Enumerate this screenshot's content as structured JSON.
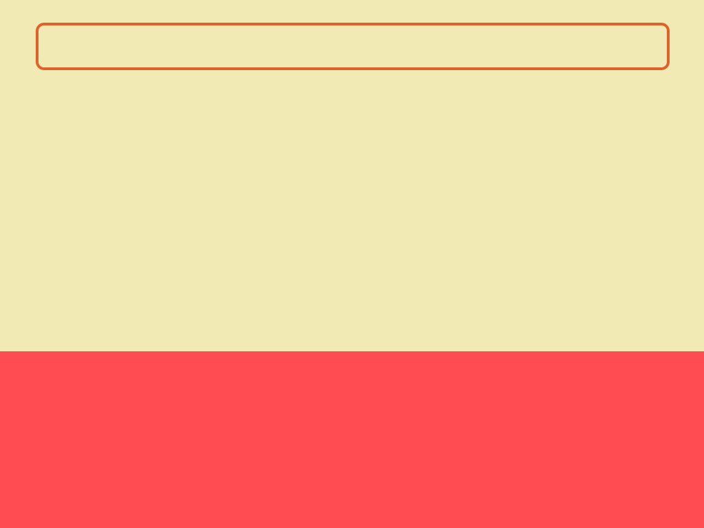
{
  "theme": {
    "background": "#f2eab5",
    "accent": "#e0612a",
    "bottom_panel": "#ff4b52"
  },
  "input": {
    "value": "",
    "placeholder": ""
  }
}
